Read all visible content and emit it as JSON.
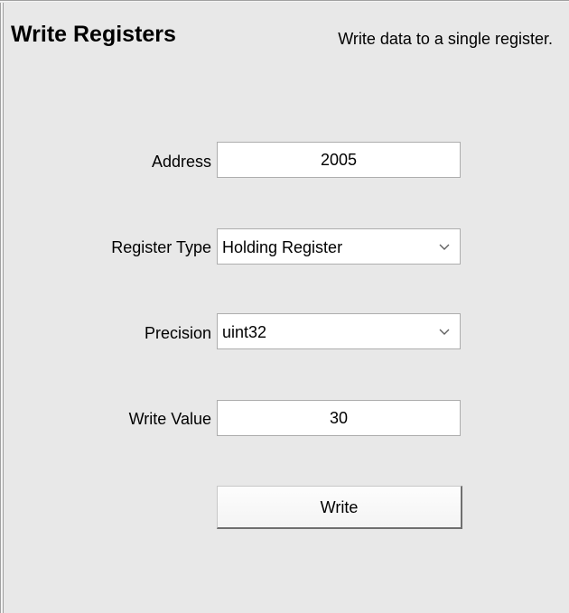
{
  "header": {
    "title": "Write Registers",
    "description": "Write data to a single register."
  },
  "form": {
    "address": {
      "label": "Address",
      "value": "2005"
    },
    "register_type": {
      "label": "Register Type",
      "selected": "Holding Register"
    },
    "precision": {
      "label": "Precision",
      "selected": "uint32"
    },
    "write_value": {
      "label": "Write Value",
      "value": "30"
    }
  },
  "actions": {
    "write_label": "Write"
  },
  "icons": {
    "dropdown": "chevron-down-icon"
  }
}
